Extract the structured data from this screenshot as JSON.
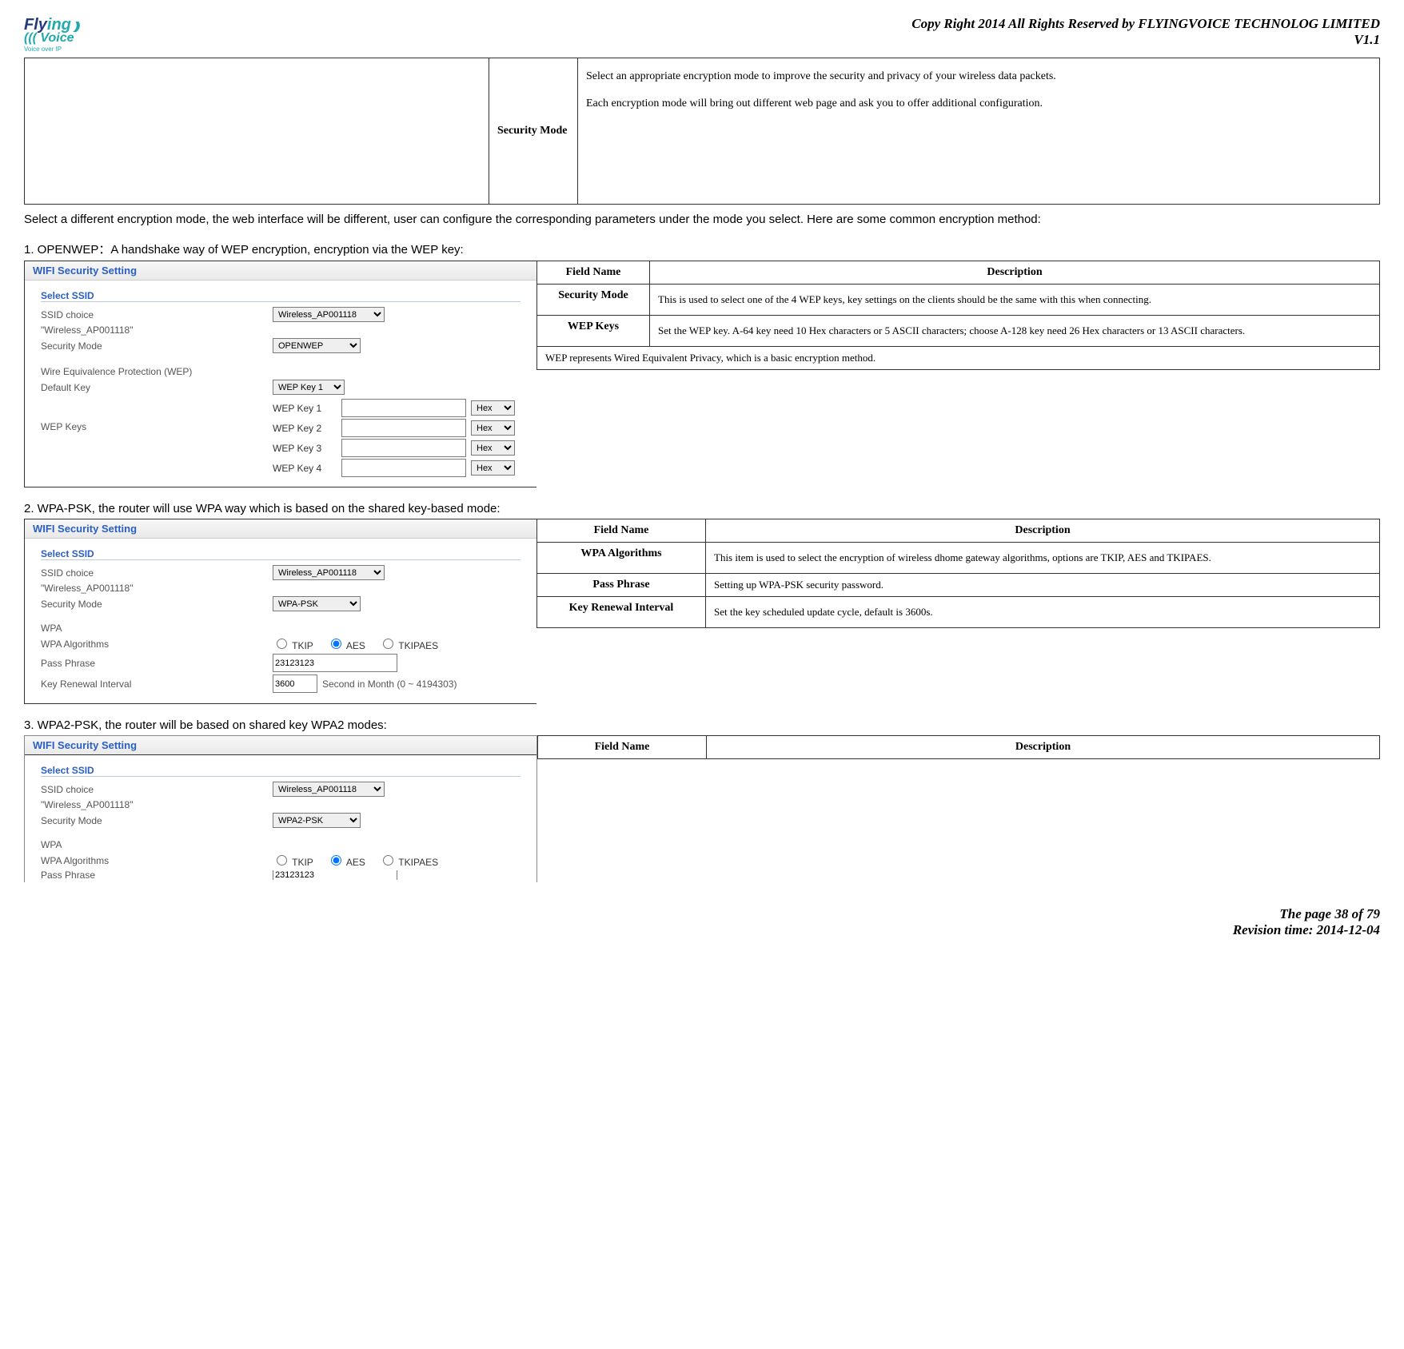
{
  "header": {
    "copyright": "Copy Right 2014 All Rights Reserved by FLYINGVOICE TECHNOLOG LIMITED",
    "version": "V1.1",
    "logo_tag": "Voice over IP"
  },
  "topTable": {
    "label": "Security Mode",
    "desc": "Select an appropriate encryption mode to improve the security and privacy of your wireless data packets.\nEach encryption mode will bring out different web page and ask you to offer additional configuration."
  },
  "introText": "Select a different encryption mode, the web interface will be different, user can configure the corresponding parameters under the mode you select. Here are some common encryption method:",
  "section1": {
    "heading": "1.  OPENWEP：A handshake way of WEP encryption, encryption via the WEP key:",
    "panelTitle": "WIFI Security Setting",
    "selectSsidLabel": "Select SSID",
    "ssidChoiceLabel": "SSID choice",
    "ssidValue": "Wireless_AP001118",
    "ssidQuoted": "\"Wireless_AP001118\"",
    "securityModeLabel": "Security Mode",
    "securityModeValue": "OPENWEP",
    "wepSectionLabel": "Wire Equivalence Protection (WEP)",
    "defaultKeyLabel": "Default Key",
    "defaultKeyValue": "WEP Key 1",
    "wepKeysGroupLabel": "WEP Keys",
    "wepKeys": [
      "WEP Key 1",
      "WEP Key 2",
      "WEP Key 3",
      "WEP Key 4"
    ],
    "hexLabel": "Hex",
    "desc": {
      "headerField": "Field Name",
      "headerDesc": "Description",
      "rows": [
        {
          "name": "Security Mode",
          "desc": "This is used to select one of the 4 WEP keys, key settings on the clients should be the same with this when connecting."
        },
        {
          "name": "WEP Keys",
          "desc": "Set the WEP key. A-64 key need 10 Hex characters or 5 ASCII characters; choose A-128 key need 26 Hex characters or 13 ASCII characters."
        }
      ],
      "footnote": "WEP represents Wired Equivalent Privacy, which is a basic encryption method."
    }
  },
  "section2": {
    "heading": "2.  WPA-PSK, the router will use WPA way which is based on the shared key-based mode:",
    "panelTitle": "WIFI Security Setting",
    "selectSsidLabel": "Select SSID",
    "ssidChoiceLabel": "SSID choice",
    "ssidValue": "Wireless_AP001118",
    "ssidQuoted": "\"Wireless_AP001118\"",
    "securityModeLabel": "Security Mode",
    "securityModeValue": "WPA-PSK",
    "wpaLabel": "WPA",
    "algLabel": "WPA Algorithms",
    "algOpts": [
      "TKIP",
      "AES",
      "TKIPAES"
    ],
    "passLabel": "Pass Phrase",
    "passValue": "23123123",
    "intervalLabel": "Key Renewal Interval",
    "intervalValue": "3600",
    "intervalSuffix": "Second in Month   (0 ~ 4194303)",
    "desc": {
      "headerField": "Field Name",
      "headerDesc": "Description",
      "rows": [
        {
          "name": "WPA Algorithms",
          "desc": "This item is used to select the encryption of wireless dhome gateway algorithms, options are TKIP, AES and TKIPAES."
        },
        {
          "name": "Pass Phrase",
          "desc": "Setting up WPA-PSK security password."
        },
        {
          "name": "Key Renewal Interval",
          "desc": "Set the key scheduled update cycle, default is 3600s."
        }
      ]
    }
  },
  "section3": {
    "heading": "3.  WPA2-PSK, the router will be based on shared key WPA2 modes:",
    "panelTitle": "WIFI Security Setting",
    "selectSsidLabel": "Select SSID",
    "ssidChoiceLabel": "SSID choice",
    "ssidValue": "Wireless_AP001118",
    "ssidQuoted": "\"Wireless_AP001118\"",
    "securityModeLabel": "Security Mode",
    "securityModeValue": "WPA2-PSK",
    "wpaLabel": "WPA",
    "algLabel": "WPA Algorithms",
    "algOpts": [
      "TKIP",
      "AES",
      "TKIPAES"
    ],
    "passLabel": "Pass Phrase",
    "passValue": "23123123",
    "desc": {
      "headerField": "Field Name",
      "headerDesc": "Description"
    }
  },
  "footer": {
    "page": "The page 38 of 79",
    "rev": "Revision time: 2014-12-04"
  }
}
